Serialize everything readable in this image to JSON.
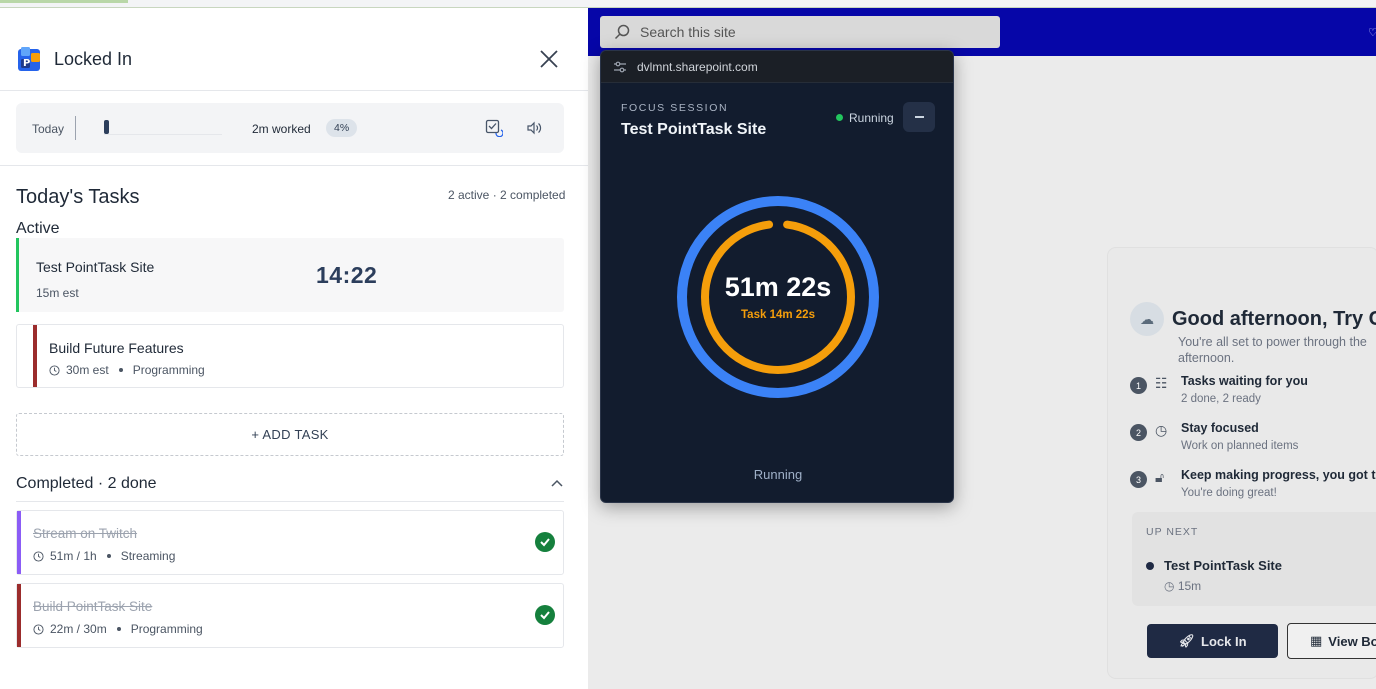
{
  "background_site": {
    "search_placeholder": "Search this site",
    "greeting_title": "Good afternoon, Try C",
    "greeting_sub": "You're all set to power through the afternoon.",
    "steps": [
      {
        "num": "1",
        "icon": "list-icon",
        "title": "Tasks waiting for you",
        "sub": "2 done, 2 ready"
      },
      {
        "num": "2",
        "icon": "clock-icon",
        "title": "Stay focused",
        "sub": "Work on planned items"
      },
      {
        "num": "3",
        "icon": "lock-icon",
        "title": "Keep making progress, you got th",
        "sub": "You're doing great!"
      }
    ],
    "upnext_label": "UP NEXT",
    "upnext_task": "Test PointTask Site",
    "upnext_time": "15m",
    "lockin_label": "Lock In",
    "viewboard_label": "View Bo"
  },
  "panel": {
    "title": "Locked In",
    "today_label": "Today",
    "progress_fraction": 0.04,
    "worked": "2m worked",
    "percent": "4%",
    "tasks_title": "Today's Tasks",
    "tasks_count": "2 active · 2 completed",
    "active_label": "Active",
    "active_tasks": [
      {
        "name": "Test PointTask Site",
        "meta": "15m est",
        "timer": "14:22",
        "stripe": "#22c55e"
      },
      {
        "name": "Build Future Features",
        "meta": "30m est",
        "category": "Programming",
        "stripe": "#9b2c2c"
      }
    ],
    "add_task": "+ ADD TASK",
    "completed_label": "Completed · 2 done",
    "completed_tasks": [
      {
        "name": "Stream on Twitch",
        "meta": "51m / 1h",
        "category": "Streaming",
        "stripe": "#8b5cf6"
      },
      {
        "name": "Build PointTask Site",
        "meta": "22m / 30m",
        "category": "Programming",
        "stripe": "#9b2c2c"
      }
    ]
  },
  "popup": {
    "url": "dvlmnt.sharepoint.com",
    "session_label": "FOCUS SESSION",
    "session_title": "Test PointTask Site",
    "status": "Running",
    "ring_time": "51m 22s",
    "ring_sub": "Task 14m 22s",
    "footer_status": "Running",
    "outer_ring_fraction": 1.0,
    "inner_ring_fraction": 0.96,
    "colors": {
      "outer_ring": "#3b82f6",
      "inner_ring": "#f59e0b",
      "background": "#121c2e"
    }
  }
}
